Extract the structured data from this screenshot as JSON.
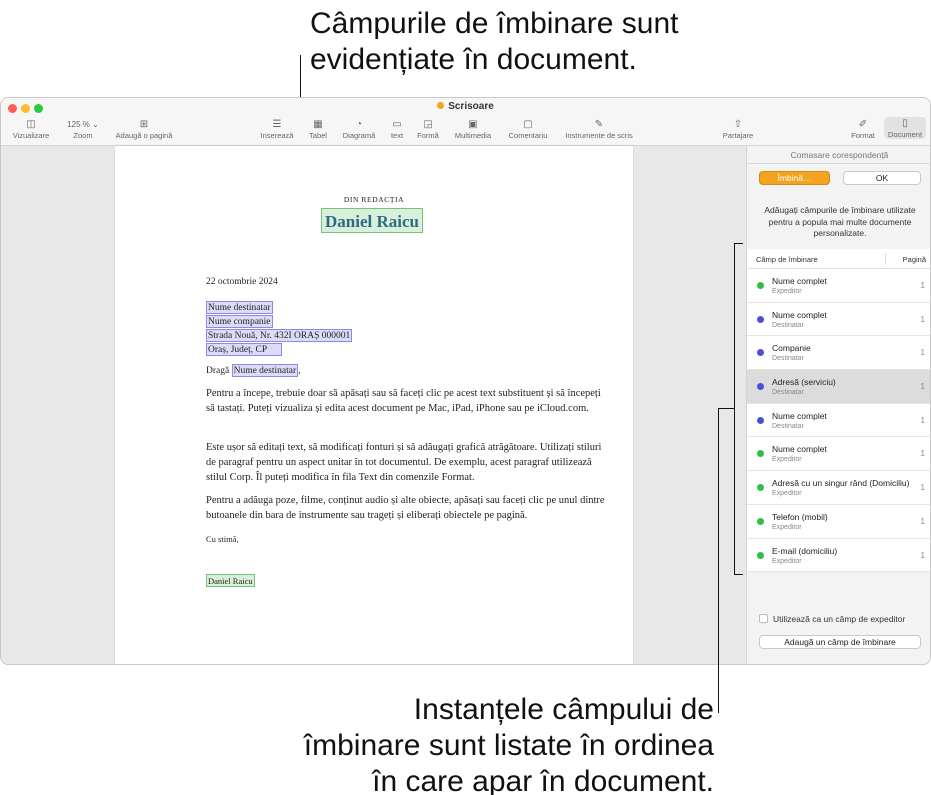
{
  "callouts": {
    "top": [
      "Câmpurile de îmbinare sunt",
      "evidențiate în document."
    ],
    "bottom": [
      "Instanțele câmpului de",
      "îmbinare sunt listate în ordinea",
      "în care apar în document."
    ]
  },
  "window": {
    "title": "Scrisoare",
    "traffic_colors": [
      "#fe5f57",
      "#febc2e",
      "#28c840"
    ],
    "title_dot_color": "#f4a320"
  },
  "toolbar": {
    "view": {
      "label": "Vizualizare",
      "icon": "sidebar-icon"
    },
    "zoom": {
      "label": "Zoom",
      "value": "125 %"
    },
    "add_page": {
      "label": "Adaugă o pagină",
      "icon": "plus-square-icon"
    },
    "insert": {
      "label": "Inserează",
      "icon": "list-insert-icon"
    },
    "table": {
      "label": "Tabel",
      "icon": "table-icon"
    },
    "chart": {
      "label": "Diagramă",
      "icon": "pie-chart-icon"
    },
    "text": {
      "label": "text",
      "icon": "text-box-icon"
    },
    "shape": {
      "label": "Formă",
      "icon": "shapes-icon"
    },
    "media": {
      "label": "Multimedia",
      "icon": "photo-icon"
    },
    "comment": {
      "label": "Comentariu",
      "icon": "comment-icon"
    },
    "writing_tools": {
      "label": "Instrumente de scris",
      "icon": "writing-tools-icon"
    },
    "share": {
      "label": "Partajare",
      "icon": "share-icon"
    },
    "format": {
      "label": "Format",
      "icon": "paintbrush-icon"
    },
    "document": {
      "label": "Document",
      "icon": "document-icon"
    }
  },
  "letter": {
    "from_label": "DIN REDACȚIA",
    "sender_name": "Daniel Raicu",
    "date": "22 octombrie 2024",
    "recipient_fields": [
      "Nume destinatar",
      "Nume companie",
      "Strada Nouă, Nr. 432I ORAȘ 000001",
      "Oraș, Județ, CP"
    ],
    "greeting_prefix": "Dragă",
    "greeting_field": "Nume destinatar",
    "greeting_suffix": ",",
    "paragraphs": [
      "Pentru a începe, trebuie doar să apăsați sau să faceți clic pe acest text substituent și să începeți să tastați. Puteți vizualiza și edita acest document pe Mac, iPad, iPhone sau pe iCloud.com.",
      "Este ușor să editați text, să modificați fonturi și să adăugați grafică atrăgătoare. Utilizați stiluri de paragraf pentru un aspect unitar în tot documentul. De exemplu, acest paragraf utilizează stilul Corp. Îl puteți modifica în fila Text din comenzile Format.",
      "Pentru a adăuga poze, filme, conținut audio și alte obiecte, apăsați sau faceți clic pe unul dintre butoanele din bara de instrumente sau trageți și eliberați obiectele pe pagină."
    ],
    "closing": "Cu stimă,",
    "signature": "Daniel Raicu"
  },
  "sidebar": {
    "title": "Comasare corespondență",
    "merge_button": "Îmbină…",
    "ok_button": "OK",
    "description": "Adăugați câmpurile de îmbinare utilizate pentru a popula mai multe documente personalizate.",
    "col_field": "Câmp de îmbinare",
    "col_page": "Pagină",
    "rows": [
      {
        "name": "Nume complet",
        "role": "Expeditor",
        "page": "1",
        "color": "#2fc043",
        "selected": false
      },
      {
        "name": "Nume complet",
        "role": "Destinatar",
        "page": "1",
        "color": "#4d4dd8",
        "selected": false
      },
      {
        "name": "Companie",
        "role": "Destinatar",
        "page": "1",
        "color": "#4d4dd8",
        "selected": false
      },
      {
        "name": "Adresă (serviciu)",
        "role": "Destinatar",
        "page": "1",
        "color": "#4d4dd8",
        "selected": true
      },
      {
        "name": "Nume complet",
        "role": "Destinatar",
        "page": "1",
        "color": "#4d4dd8",
        "selected": false
      },
      {
        "name": "Nume complet",
        "role": "Expeditor",
        "page": "1",
        "color": "#2fc043",
        "selected": false
      },
      {
        "name": "Adresă cu un singur rând (Domiciliu)",
        "role": "Expeditor",
        "page": "1",
        "color": "#2fc043",
        "selected": false
      },
      {
        "name": "Telefon (mobil)",
        "role": "Expeditor",
        "page": "1",
        "color": "#2fc043",
        "selected": false
      },
      {
        "name": "E-mail (domiciliu)",
        "role": "Expeditor",
        "page": "1",
        "color": "#2fc043",
        "selected": false
      }
    ],
    "checkbox_label": "Utilizează ca un câmp de expeditor",
    "add_field_button": "Adaugă un câmp de îmbinare"
  }
}
